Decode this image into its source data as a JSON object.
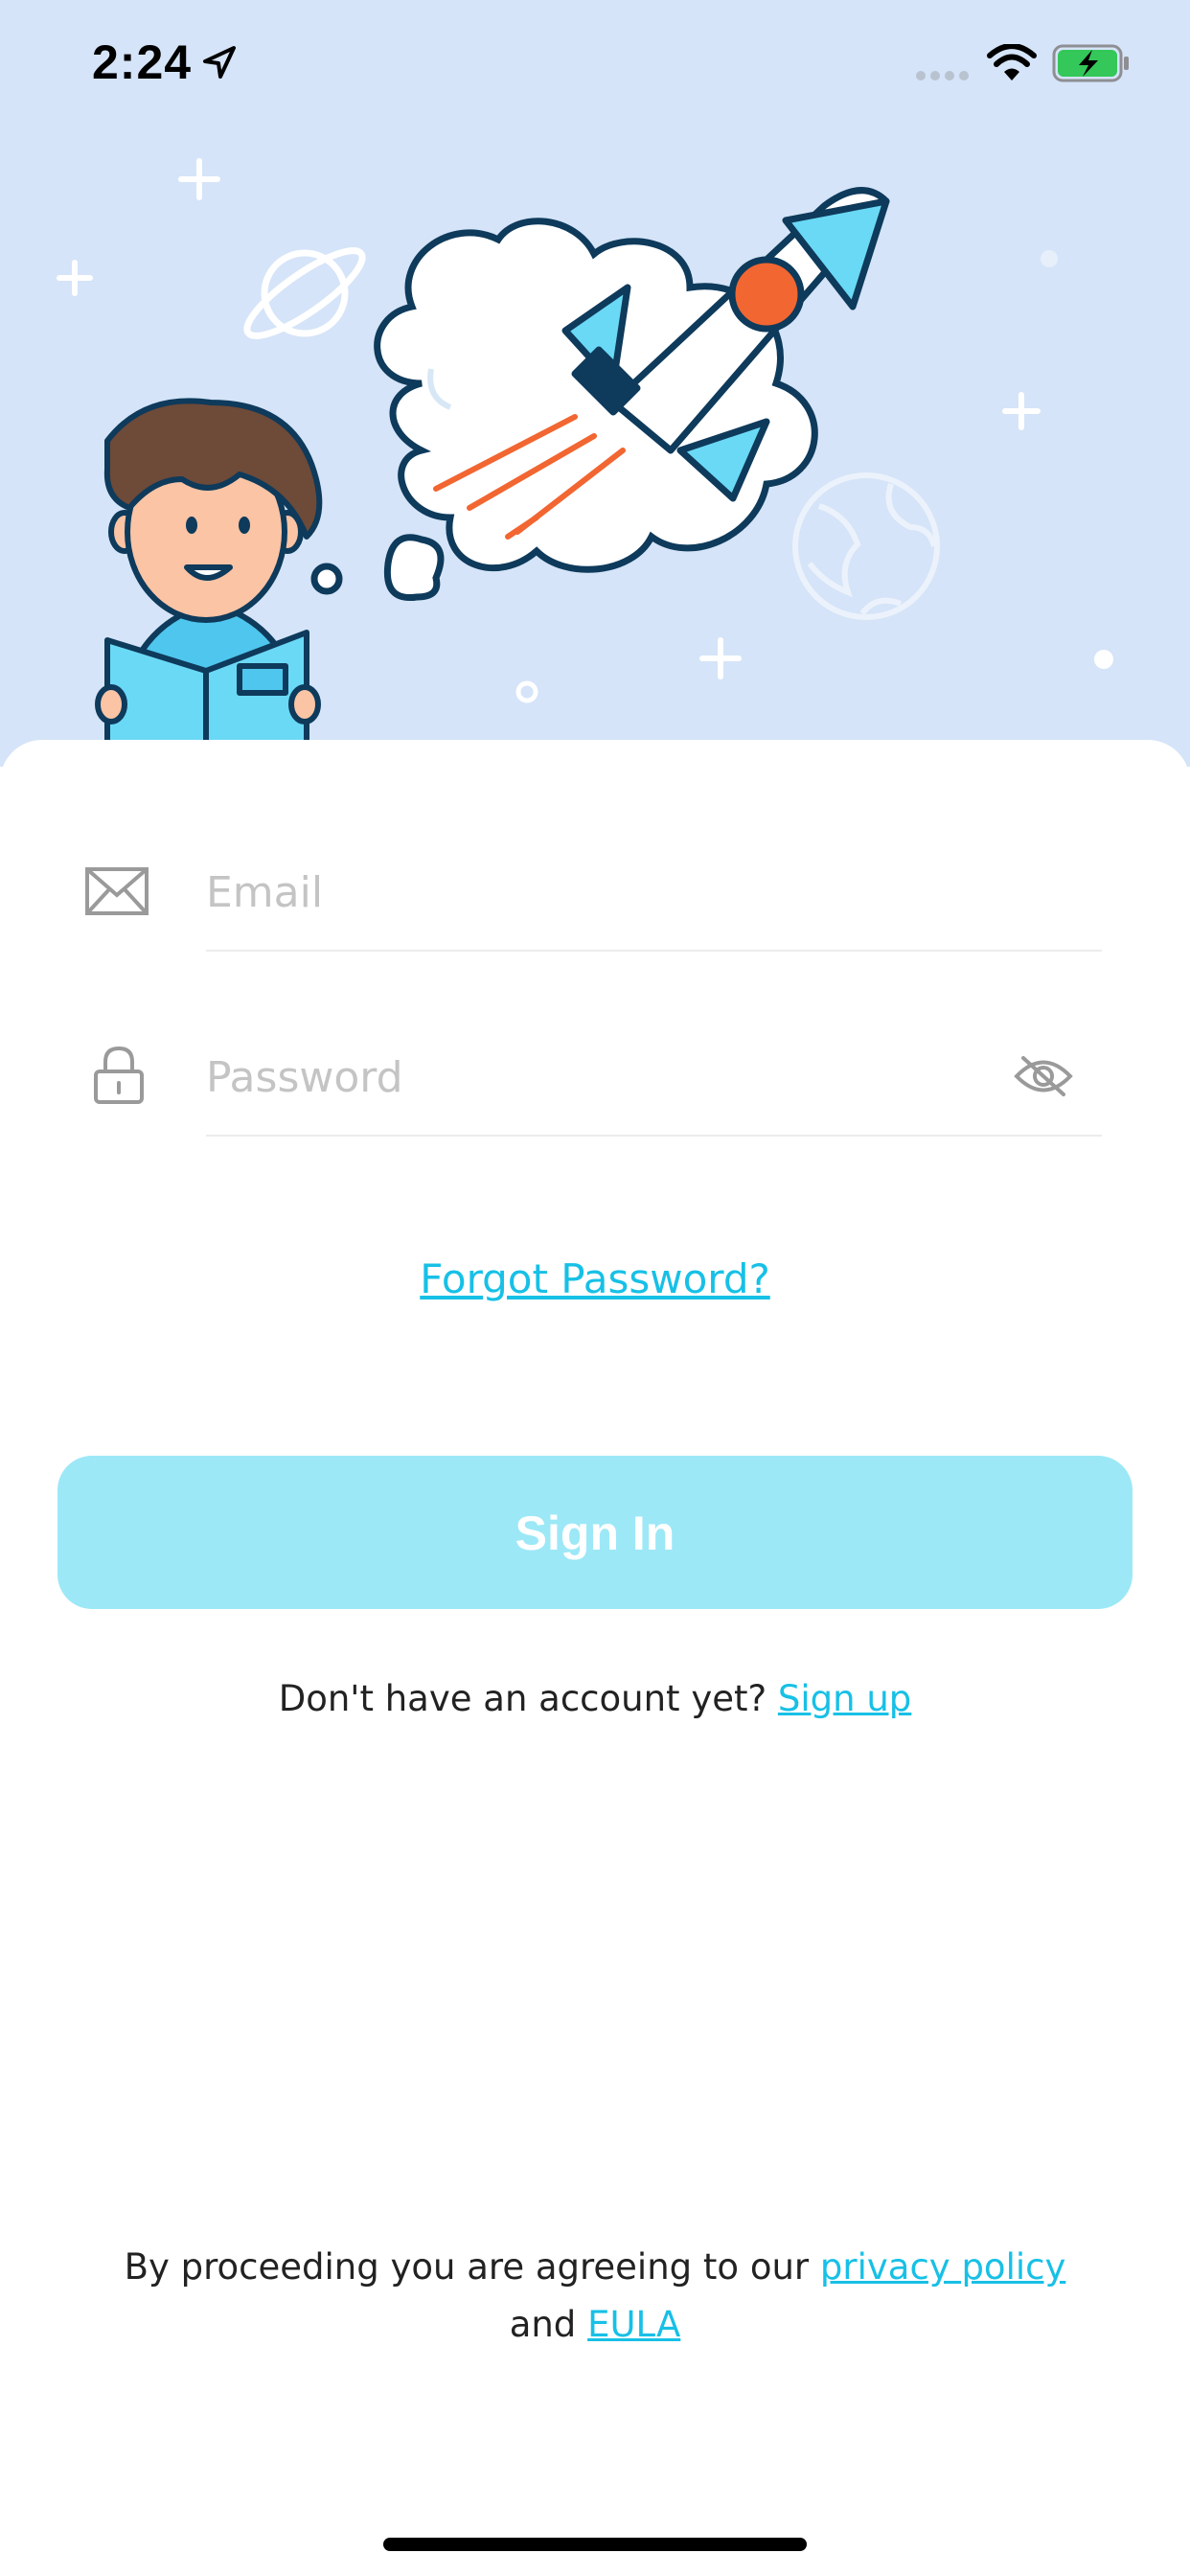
{
  "status_bar": {
    "time": "2:24",
    "icons": [
      "location-arrow-icon",
      "signal-dots-icon",
      "wifi-icon",
      "battery-charging-icon"
    ]
  },
  "hero": {
    "illustration": "boy-reading-book-dreaming-rocket",
    "background_color": "#d5e4f8"
  },
  "form": {
    "email": {
      "icon": "envelope-icon",
      "placeholder": "Email",
      "value": ""
    },
    "password": {
      "icon": "lock-icon",
      "placeholder": "Password",
      "value": "",
      "toggle_icon": "eye-slash-icon"
    }
  },
  "forgot_password": "Forgot Password?",
  "sign_in_button": "Sign In",
  "signup": {
    "prompt": "Don't have an account yet?",
    "link": "Sign up"
  },
  "legal": {
    "prefix": "By proceeding you are agreeing to our",
    "privacy_link": "privacy policy",
    "and": "and",
    "eula_link": "EULA"
  },
  "colors": {
    "accent": "#17c0e6",
    "button": "#9ce8f7",
    "hero_bg": "#d5e4f8"
  }
}
